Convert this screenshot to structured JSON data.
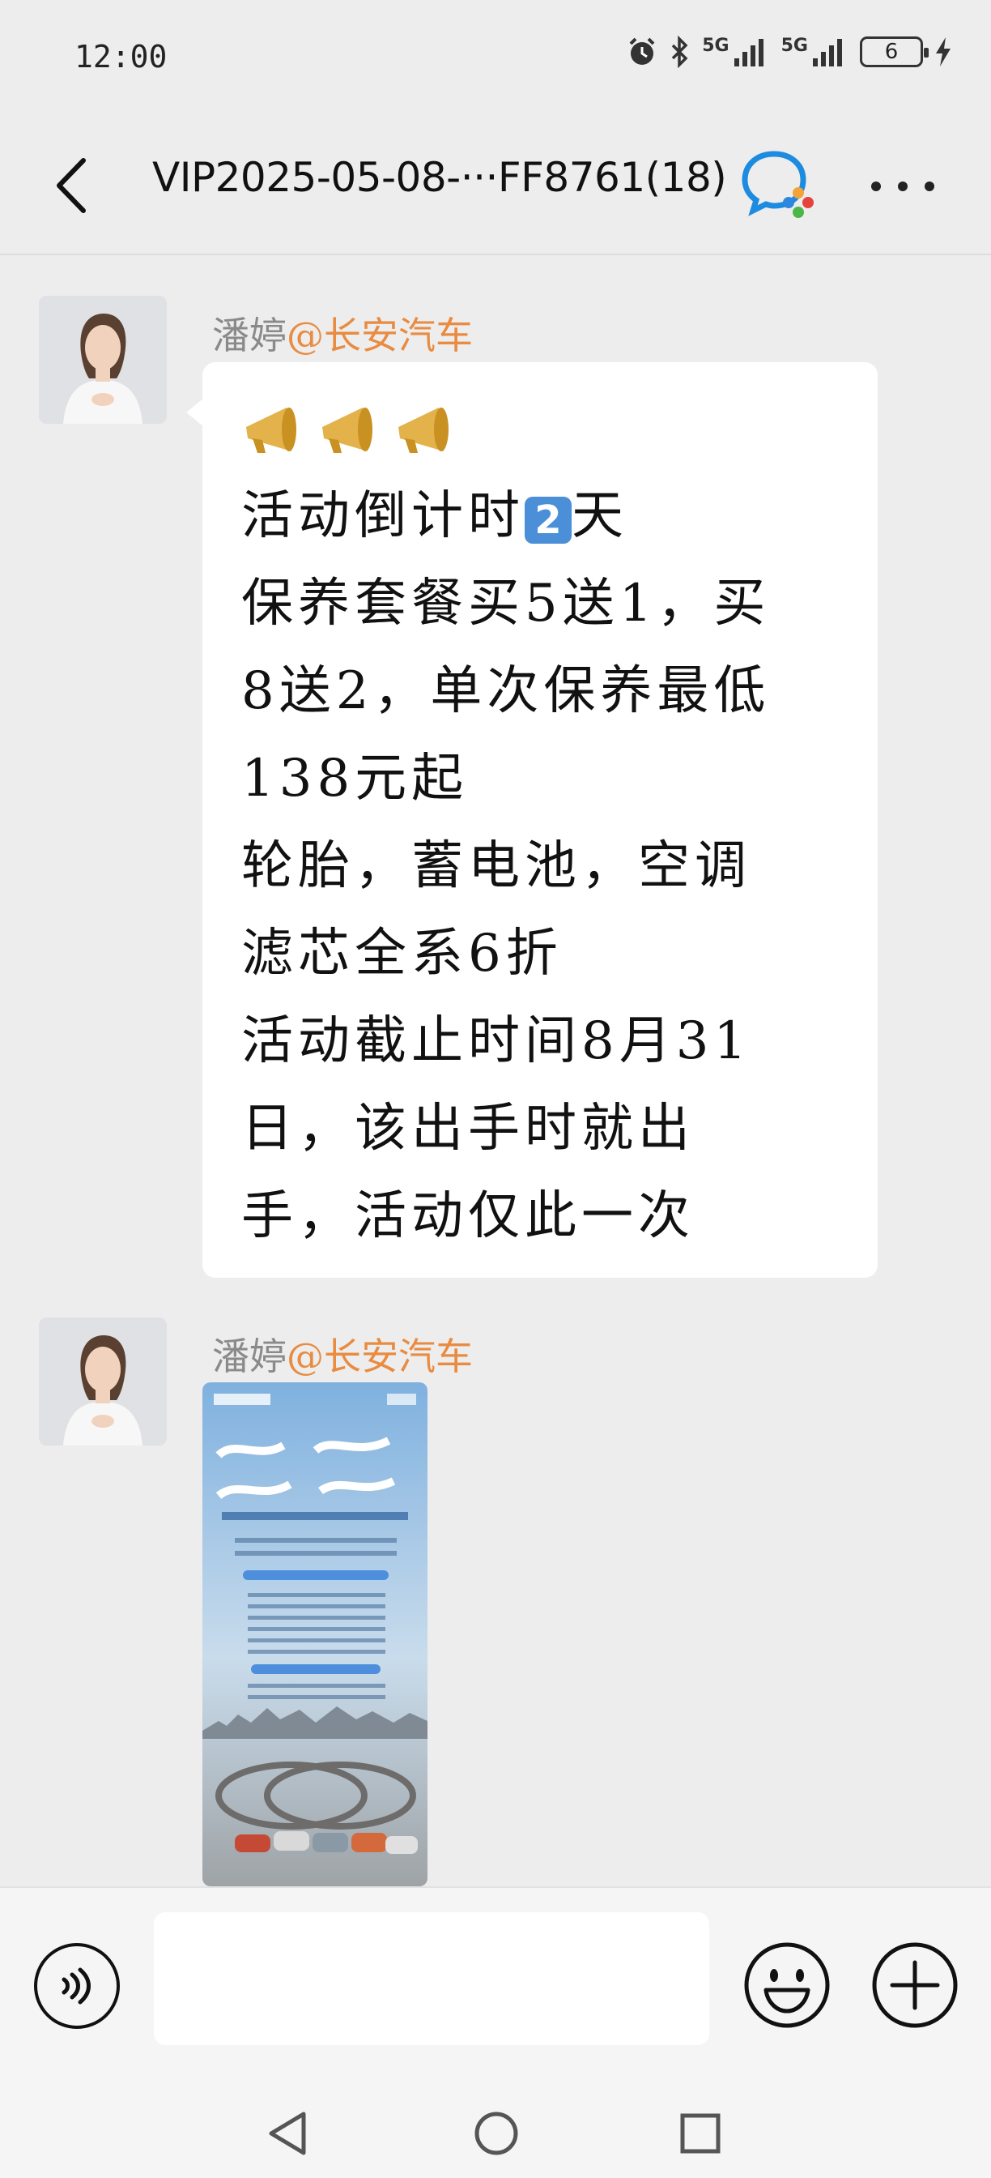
{
  "status_bar": {
    "time": "12:00",
    "network_1": "5G",
    "network_2": "5G",
    "battery": "6"
  },
  "header": {
    "title": "VIP2025-05-08-···FF8761(18)"
  },
  "messages": [
    {
      "sender_name": "潘婷",
      "sender_company": "@长安汽车",
      "type": "text",
      "lines": [
        "活动倒计时",
        "保养套餐买5送1，买",
        "8送2，单次保养最低",
        "138元起",
        "轮胎，蓄电池，空调",
        "滤芯全系6折",
        "活动截止时间8月31",
        "日，该出手时就出",
        "手，活动仅此一次"
      ],
      "countdown_badge": "2",
      "countdown_suffix": "天"
    },
    {
      "sender_name": "潘婷",
      "sender_company": "@长安汽车",
      "type": "image"
    }
  ],
  "input": {
    "placeholder": ""
  }
}
